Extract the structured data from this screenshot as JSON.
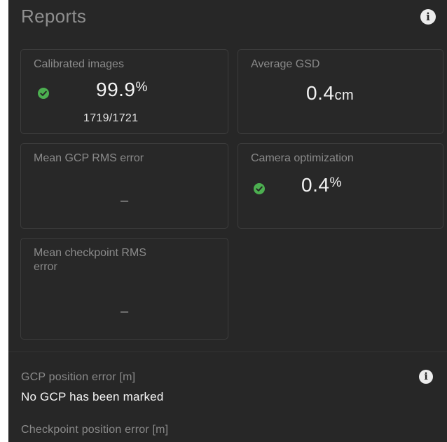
{
  "header": {
    "title": "Reports",
    "info_icon": "info-icon"
  },
  "cards": {
    "calibrated_images": {
      "label": "Calibrated images",
      "status_icon": "check-circle-icon",
      "value": "99.9",
      "unit": "%",
      "sub": "1719/1721"
    },
    "average_gsd": {
      "label": "Average GSD",
      "value": "0.4",
      "unit": "cm"
    },
    "mean_gcp_rms": {
      "label": "Mean GCP RMS error",
      "value": "–"
    },
    "camera_optimization": {
      "label": "Camera optimization",
      "status_icon": "check-circle-icon",
      "value": "0.4",
      "unit": "%"
    },
    "mean_checkpoint_rms": {
      "label_line1": "Mean checkpoint RMS",
      "label_line2": "error",
      "value": "–"
    }
  },
  "gcp_section": {
    "title": "GCP position error [m]",
    "value": "No GCP has been marked",
    "info_icon": "info-icon"
  },
  "checkpoint_section": {
    "title": "Checkpoint position error [m]"
  },
  "colors": {
    "background": "#272727",
    "card_border": "#3c3c3c",
    "success": "#4caf50",
    "label": "#8a8a8a",
    "value": "#f2f2f2"
  }
}
